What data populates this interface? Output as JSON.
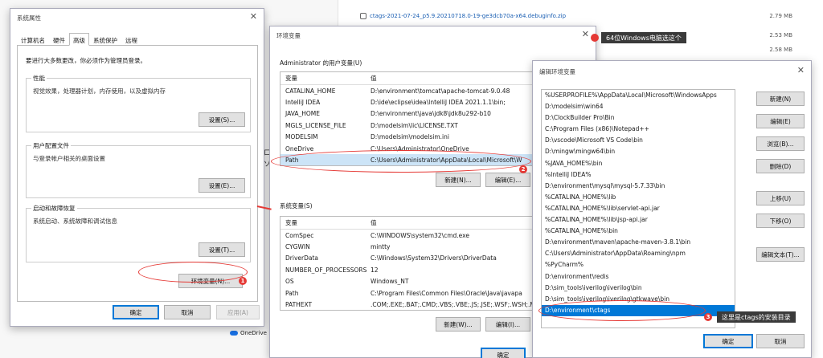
{
  "background": {
    "downloads": [
      {
        "name": "ctags-2021-07-24_p5.9.20210718.0-19-ge3dcb70a-x64.debuginfo.zip",
        "size": "2.79 MB"
      },
      {
        "name": "",
        "size": "2.53 MB"
      },
      {
        "name": "",
        "size": "2.58 MB"
      }
    ],
    "onedrive_label": "OneDrive",
    "partial_letters": [
      "ロ",
      "ソ"
    ]
  },
  "sysprops": {
    "title": "系统属性",
    "tabs": [
      "计算机名",
      "硬件",
      "高级",
      "系统保护",
      "远程"
    ],
    "active_tab": "高级",
    "admin_note": "要进行大多数更改，你必须作为管理员登录。",
    "groups": [
      {
        "legend": "性能",
        "desc": "视觉效果，处理器计划，内存使用，以及虚拟内存",
        "button": "设置(S)..."
      },
      {
        "legend": "用户配置文件",
        "desc": "与登录帐户相关的桌面设置",
        "button": "设置(E)..."
      },
      {
        "legend": "启动和故障恢复",
        "desc": "系统启动、系统故障和调试信息",
        "button": "设置(T)..."
      }
    ],
    "env_button": "环境变量(N)...",
    "ok": "确定",
    "cancel": "取消",
    "apply": "应用(A)"
  },
  "envvars": {
    "title": "环境变量",
    "user_section": "Administrator 的用户变量(U)",
    "col_var": "变量",
    "col_val": "值",
    "user_vars": [
      {
        "name": "CATALINA_HOME",
        "value": "D:\\environment\\tomcat\\apache-tomcat-9.0.48"
      },
      {
        "name": "IntelliJ IDEA",
        "value": "D:\\ide\\eclipse\\idea\\IntelliJ IDEA 2021.1.1\\bin;"
      },
      {
        "name": "JAVA_HOME",
        "value": "D:\\environment\\java\\jdk8\\jdk8u292-b10"
      },
      {
        "name": "MGLS_LICENSE_FILE",
        "value": "D:\\modelsim\\lic\\LICENSE.TXT"
      },
      {
        "name": "MODELSIM",
        "value": "D:\\modelsim\\modelsim.ini"
      },
      {
        "name": "OneDrive",
        "value": "C:\\Users\\Administrator\\OneDrive"
      },
      {
        "name": "Path",
        "value": "C:\\Users\\Administrator\\AppData\\Local\\Microsoft\\W"
      }
    ],
    "user_new": "新建(N)...",
    "user_edit": "编辑(E)...",
    "sys_section": "系统变量(S)",
    "sys_vars": [
      {
        "name": "ComSpec",
        "value": "C:\\WINDOWS\\system32\\cmd.exe"
      },
      {
        "name": "CYGWIN",
        "value": "mintty"
      },
      {
        "name": "DriverData",
        "value": "C:\\Windows\\System32\\Drivers\\DriverData"
      },
      {
        "name": "NUMBER_OF_PROCESSORS",
        "value": "12"
      },
      {
        "name": "OS",
        "value": "Windows_NT"
      },
      {
        "name": "Path",
        "value": "C:\\Program Files\\Common Files\\Oracle\\Java\\javapa"
      },
      {
        "name": "PATHEXT",
        "value": ".COM;.EXE;.BAT;.CMD;.VBS;.VBE;.JS;.JSE;.WSF;.WSH;.M"
      }
    ],
    "sys_new": "新建(W)...",
    "sys_edit": "编辑(I)...",
    "ok": "确定"
  },
  "editenv": {
    "title": "编辑环境变量",
    "entries": [
      "%USERPROFILE%\\AppData\\Local\\Microsoft\\WindowsApps",
      "D:\\modelsim\\win64",
      "D:\\ClockBuilder Pro\\Bin",
      "C:\\Program Files (x86)\\Notepad++",
      "D:\\vscode\\Microsoft VS Code\\bin",
      "D:\\mingw\\mingw64\\bin",
      "%JAVA_HOME%\\bin",
      "%IntelliJ IDEA%",
      "D:\\environment\\mysql\\mysql-5.7.33\\bin",
      "%CATALINA_HOME%\\lib",
      "%CATALINA_HOME%\\lib\\servlet-api.jar",
      "%CATALINA_HOME%\\lib\\jsp-api.jar",
      "%CATALINA_HOME%\\bin",
      "D:\\environment\\maven\\apache-maven-3.8.1\\bin",
      "C:\\Users\\Administrator\\AppData\\Roaming\\npm",
      "%PyCharm%",
      "D:\\environment\\redis",
      "D:\\sim_tools\\iverilog\\iverilog\\bin",
      "D:\\sim_tools\\iverilog\\iverilog\\gtkwave\\bin",
      "D:\\environment\\ctags"
    ],
    "selected_index": 19,
    "buttons": [
      "新建(N)",
      "编辑(E)",
      "浏览(B)...",
      "删除(D)",
      "上移(U)",
      "下移(O)",
      "编辑文本(T)..."
    ],
    "ok": "确定",
    "cancel": "取消"
  },
  "annotations": {
    "badges": [
      "1",
      "2",
      "3"
    ],
    "callout_top": "64位Windows电脑选这个",
    "callout_bottom": "这里是ctags的安装目录",
    "color": "#e53935"
  }
}
